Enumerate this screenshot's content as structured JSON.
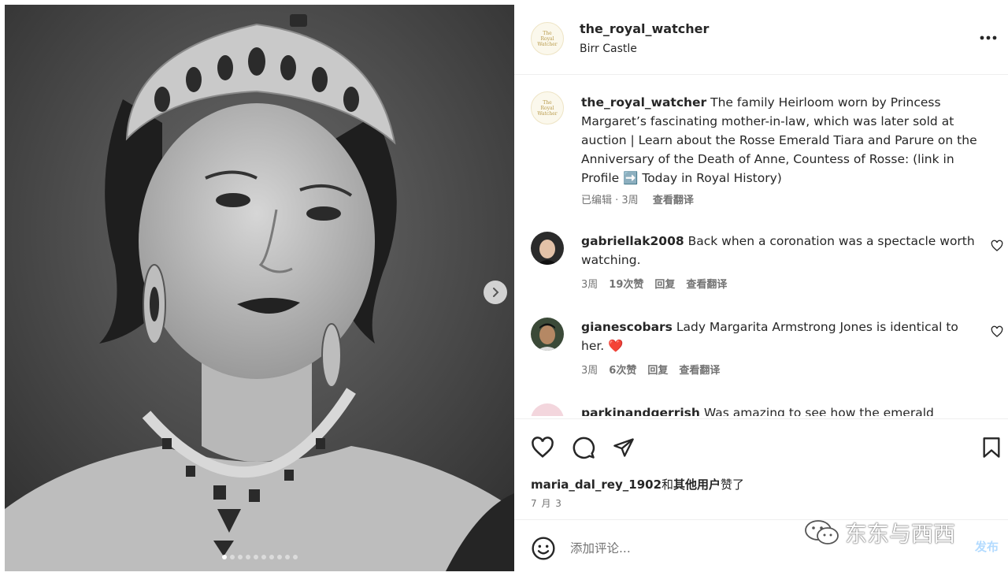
{
  "post": {
    "username": "the_royal_watcher",
    "location": "Birr Castle",
    "avatar_text": [
      "The",
      "Royal",
      "Watcher"
    ]
  },
  "caption": {
    "username": "the_royal_watcher",
    "text": "The family Heirloom worn by Princess Margaret’s fascinating mother-in-law, which was later sold at auction | Learn about the Rosse Emerald Tiara and Parure on the Anniversary of the Death of Anne, Countess of Rosse: (link in Profile ",
    "text_end": " Today in Royal History)",
    "arrow_emoji": "➡️",
    "edited": "已编辑 · 3周",
    "translate": "查看翻译"
  },
  "comments": [
    {
      "username": "gabriellak2008",
      "text": "Back when a coronation was a spectacle worth watching.",
      "time": "3周",
      "likes": "19次赞",
      "reply": "回复",
      "translate": "查看翻译"
    },
    {
      "username": "gianescobars",
      "text": "Lady Margarita Armstrong Jones is identical to her.",
      "heart_emoji": "❤️",
      "time": "3周",
      "likes": "6次赞",
      "reply": "回复",
      "translate": "查看翻译"
    },
    {
      "username": "parkinandgerrish",
      "text": "Was amazing to see how the emerald"
    }
  ],
  "likes_line": {
    "user": "maria_dal_rey_1902",
    "and": "和",
    "others": "其他用户",
    "liked": "赞了"
  },
  "date": "7 月 3",
  "add_comment": {
    "placeholder": "添加评论...",
    "post_label": "发布"
  },
  "watermark": "东东与西西",
  "carousel": {
    "total": 10,
    "active": 1
  },
  "icons": [
    "more-icon",
    "heart-icon",
    "comment-icon",
    "share-icon",
    "bookmark-icon",
    "emoji-icon",
    "chevron-right-icon"
  ],
  "colors": {
    "accent": "#0095f6",
    "heart_red": "#e0245e",
    "muted": "#737373"
  }
}
